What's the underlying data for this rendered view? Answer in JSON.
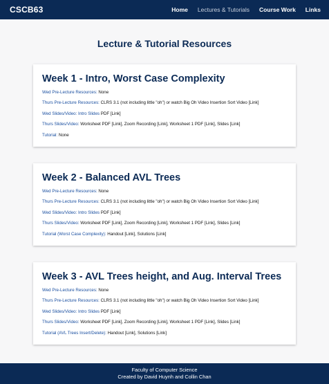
{
  "nav": {
    "brand": "CSCB63",
    "links": [
      {
        "label": "Home",
        "active": false
      },
      {
        "label": "Lectures & Tutorials",
        "active": true
      },
      {
        "label": "Course Work",
        "active": false
      },
      {
        "label": "Links",
        "active": false
      }
    ]
  },
  "page_title": "Lecture & Tutorial Resources",
  "weeks": [
    {
      "title": "Week 1 - Intro, Worst Case Complexity",
      "rows": [
        {
          "label": "Wed Pre-Lecture Resources:",
          "value": " None"
        },
        {
          "label": "Thurs Pre-Lecture Resources:",
          "value": " CLRS 3.1 (not including little \"oh\") or watch Big Oh Video Insertion Sort Video [Link]"
        },
        {
          "label": "Wed Slides/Video: Intro Slides",
          "value": " PDF [Link]"
        },
        {
          "label": "Thurs Slides/Video:",
          "value": " Worksheet PDF [Link], Zoom Recording [Link], Worksheet 1 PDF [Link], Slides [Link]"
        },
        {
          "label": "Tutorial:",
          "value": " None"
        }
      ]
    },
    {
      "title": "Week 2 - Balanced AVL Trees",
      "rows": [
        {
          "label": "Wed Pre-Lecture Resources:",
          "value": " None"
        },
        {
          "label": "Thurs Pre-Lecture Resources:",
          "value": " CLRS 3.1 (not including little \"oh\") or watch Big Oh Video Insertion Sort Video [Link]"
        },
        {
          "label": "Wed Slides/Video: Intro Slides",
          "value": " PDF [Link]"
        },
        {
          "label": "Thurs Slides/Video:",
          "value": " Worksheet PDF [Link], Zoom Recording [Link], Worksheet 1 PDF [Link], Slides [Link]"
        },
        {
          "label": "Tutorial (Worst Case Complexity):",
          "value": " Handout [Link], Solutions [Link]"
        }
      ]
    },
    {
      "title": "Week 3 - AVL Trees height, and Aug. Interval Trees",
      "rows": [
        {
          "label": "Wed Pre-Lecture Resources:",
          "value": " None"
        },
        {
          "label": "Thurs Pre-Lecture Resources:",
          "value": " CLRS 3.1 (not including little \"oh\") or watch Big Oh Video Insertion Sort Video [Link]"
        },
        {
          "label": "Wed Slides/Video: Intro Slides",
          "value": " PDF [Link]"
        },
        {
          "label": "Thurs Slides/Video:",
          "value": " Worksheet PDF [Link], Zoom Recording [Link], Worksheet 1 PDF [Link], Slides [Link]"
        },
        {
          "label": "Tutorial (AVL Trees Insert/Delete):",
          "value": " Handout [Link], Solutions [Link]"
        }
      ]
    }
  ],
  "footer": {
    "line1": "Faculty of Computer Science",
    "line2": "Created by David Huynh and Collin Chan"
  },
  "colors": {
    "navy": "#0b2a55",
    "link_blue": "#1a4fa0"
  }
}
